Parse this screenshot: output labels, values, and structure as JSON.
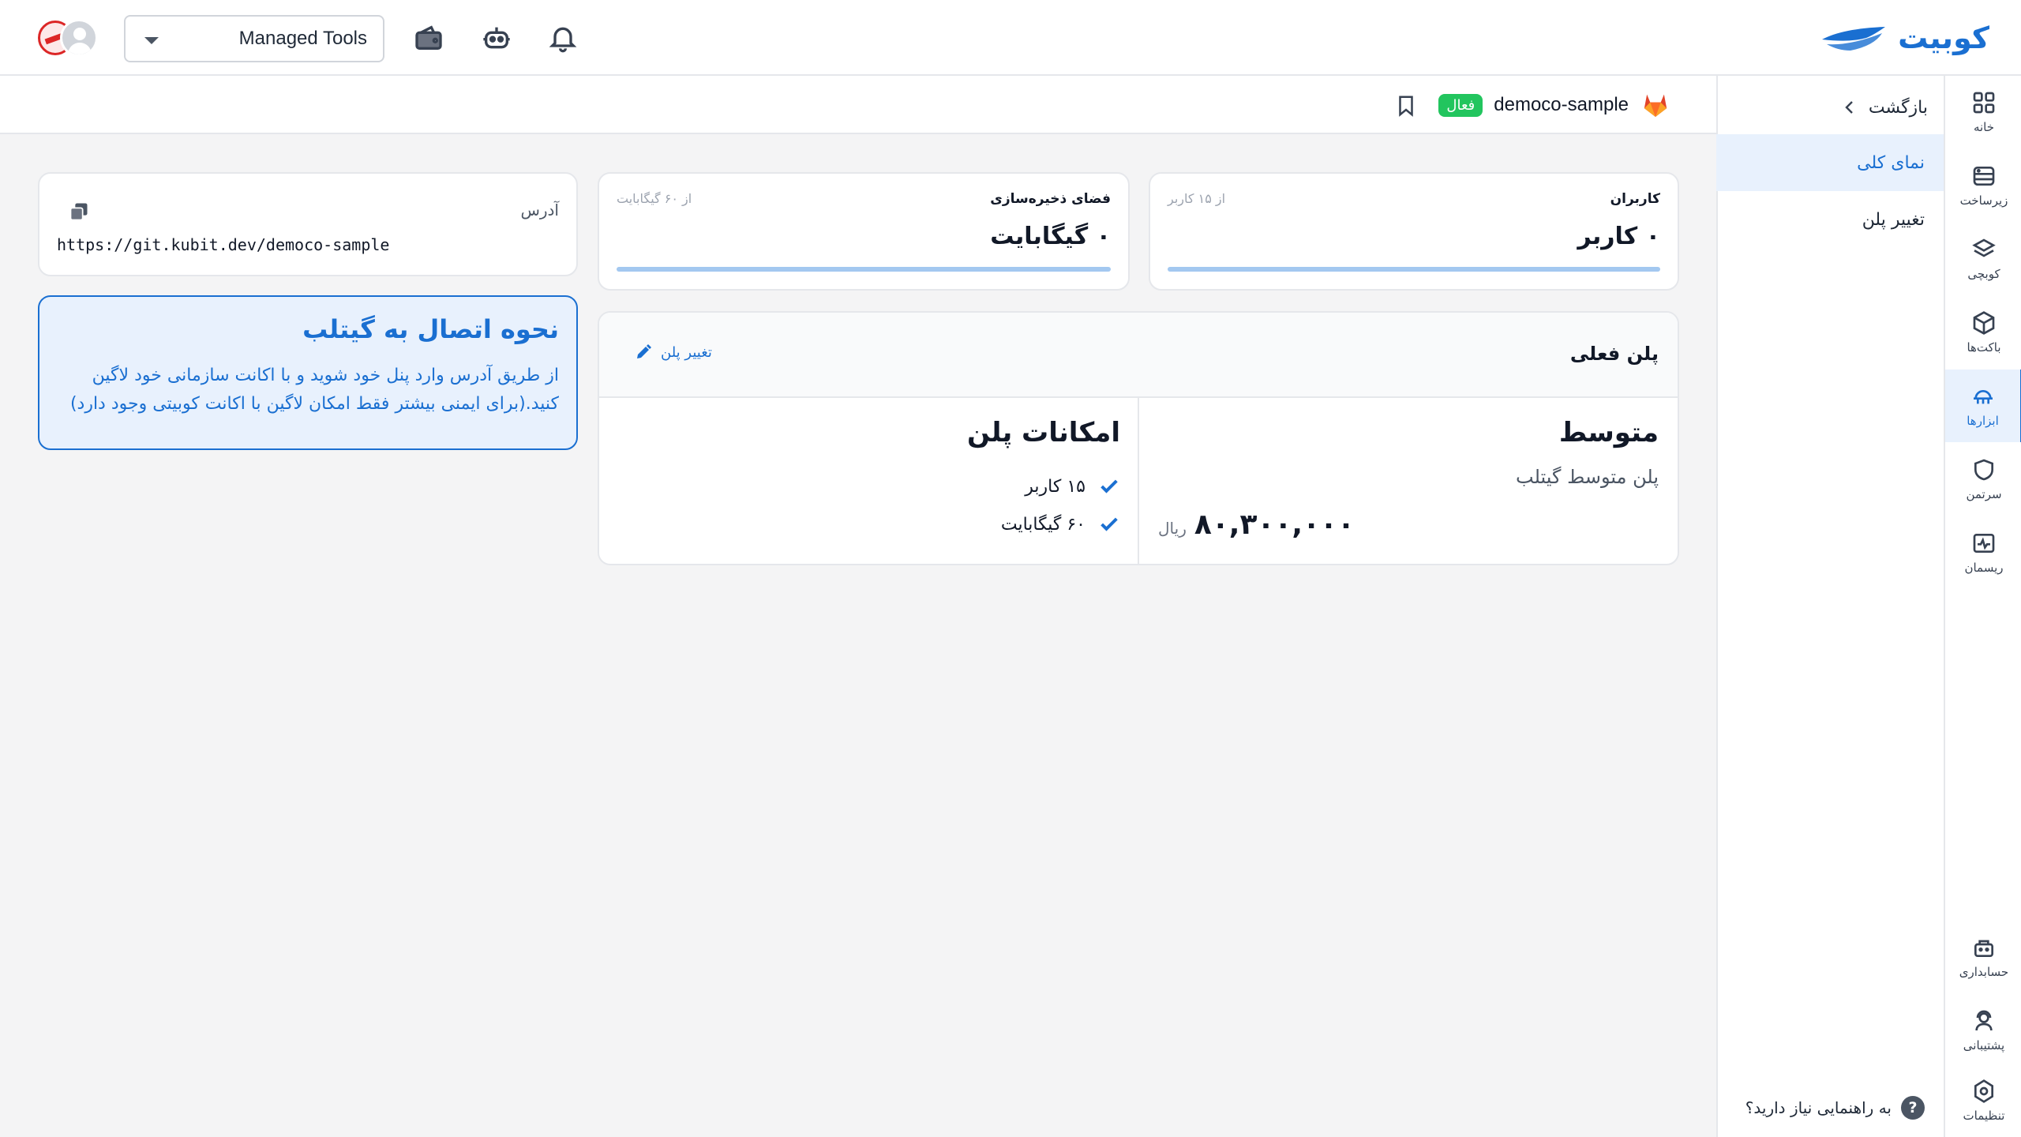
{
  "header": {
    "logo_text": "کوبیت",
    "org_selector": {
      "value": "Managed Tools"
    },
    "icons": [
      "wallet-icon",
      "robot-icon",
      "bell-icon"
    ]
  },
  "rail": {
    "items": [
      {
        "label": "خانه",
        "icon": "home-grid-icon",
        "active": false
      },
      {
        "label": "زیرساخت",
        "icon": "server-icon",
        "active": false
      },
      {
        "label": "کوبچی",
        "icon": "layers-icon",
        "active": false
      },
      {
        "label": "باکت‌ها",
        "icon": "box-icon",
        "active": false
      },
      {
        "label": "ابزارها",
        "icon": "tools-icon",
        "active": true
      },
      {
        "label": "سرتمن",
        "icon": "shield-icon",
        "active": false
      },
      {
        "label": "ریسمان",
        "icon": "pulse-icon",
        "active": false
      }
    ],
    "bottom_items": [
      {
        "label": "حسابداری",
        "icon": "accounting-icon"
      },
      {
        "label": "پشتیبانی",
        "icon": "support-icon"
      },
      {
        "label": "تنظیمات",
        "icon": "settings-icon"
      }
    ]
  },
  "submenu": {
    "back_label": "بازگشت",
    "items": [
      {
        "label": "نمای کلی",
        "active": true
      },
      {
        "label": "تغییر پلن",
        "active": false
      }
    ],
    "help_label": "به راهنمایی نیاز دارید؟",
    "help_mark": "?"
  },
  "subheader": {
    "service_name": "democo-sample",
    "status_badge": "فعال"
  },
  "stats": {
    "users": {
      "title": "کاربران",
      "limit": "از ۱۵ کاربر",
      "value": "۰ کاربر",
      "used": 0,
      "max": 15
    },
    "storage": {
      "title": "فضای ذخیره‌سازی",
      "limit": "از ۶۰ گیگابایت",
      "value": "۰ گیگابایت",
      "used": 0,
      "max": 60
    }
  },
  "address": {
    "label": "آدرس",
    "value": "https://git.kubit.dev/democo-sample"
  },
  "info": {
    "title": "نحوه اتصال به گیتلب",
    "body": "از طریق آدرس وارد پنل خود شوید و با اکانت سازمانی خود لاگین کنید.(برای ایمنی بیشتر فقط امکان لاگین با اکانت کوبیتی وجود دارد)"
  },
  "plan": {
    "header_title": "پلن فعلی",
    "change_label": "تغییر پلن",
    "name": "متوسط",
    "description": "پلن متوسط گیتلب",
    "price": "۸۰,۳۰۰,۰۰۰",
    "currency": "ریال",
    "features_title": "امکانات پلن",
    "features": [
      "۱۵ کاربر",
      "۶۰ گیگابایت"
    ]
  },
  "colors": {
    "primary": "#1a6fd1",
    "active_badge": "#22c55e",
    "gitlab": "#e24329"
  }
}
